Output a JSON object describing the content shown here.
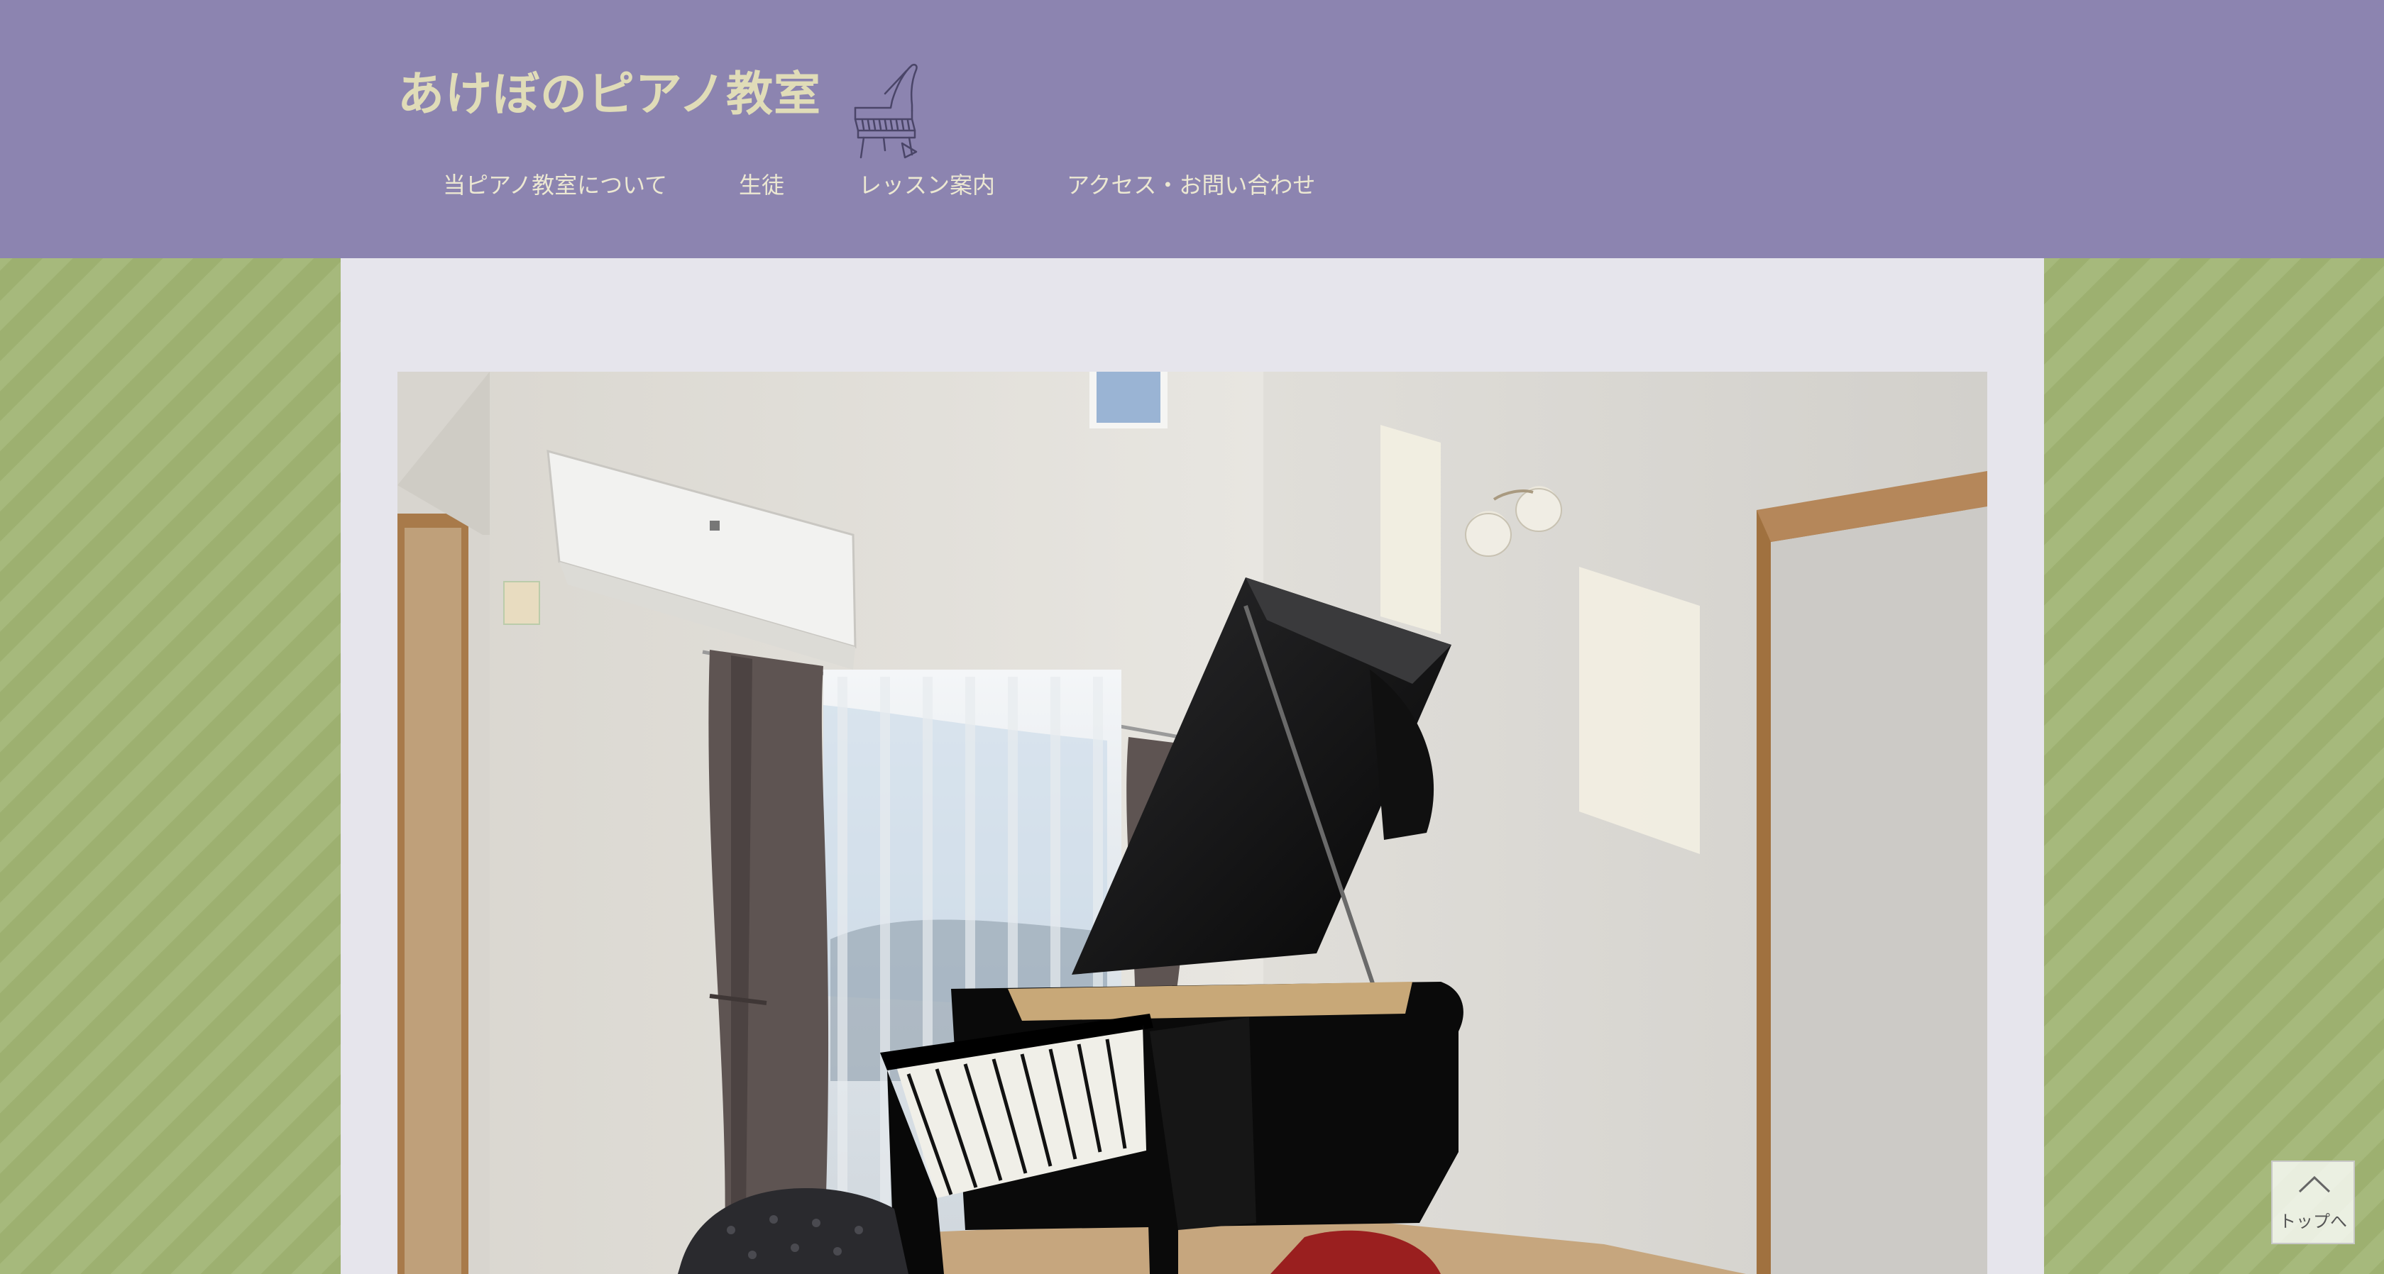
{
  "header": {
    "site_title": "あけぼのピアノ教室",
    "logo_icon": "grand-piano-line-drawing"
  },
  "nav": {
    "items": [
      {
        "label": "当ピアノ教室について"
      },
      {
        "label": "生徒"
      },
      {
        "label": "レッスン案内"
      },
      {
        "label": "アクセス・お問い合わせ"
      }
    ]
  },
  "hero": {
    "image": "grand-piano-in-lesson-room-photo"
  },
  "to_top": {
    "label": "トップへ",
    "icon": "chevron-up-icon"
  },
  "colors": {
    "header_bg": "#8c84b0",
    "title_text": "#e0dcb8",
    "nav_text": "#ece8d2",
    "content_bg": "#e6e5ec",
    "side_stripe_light": "#a6b97c",
    "side_stripe_dark": "#9db070"
  }
}
